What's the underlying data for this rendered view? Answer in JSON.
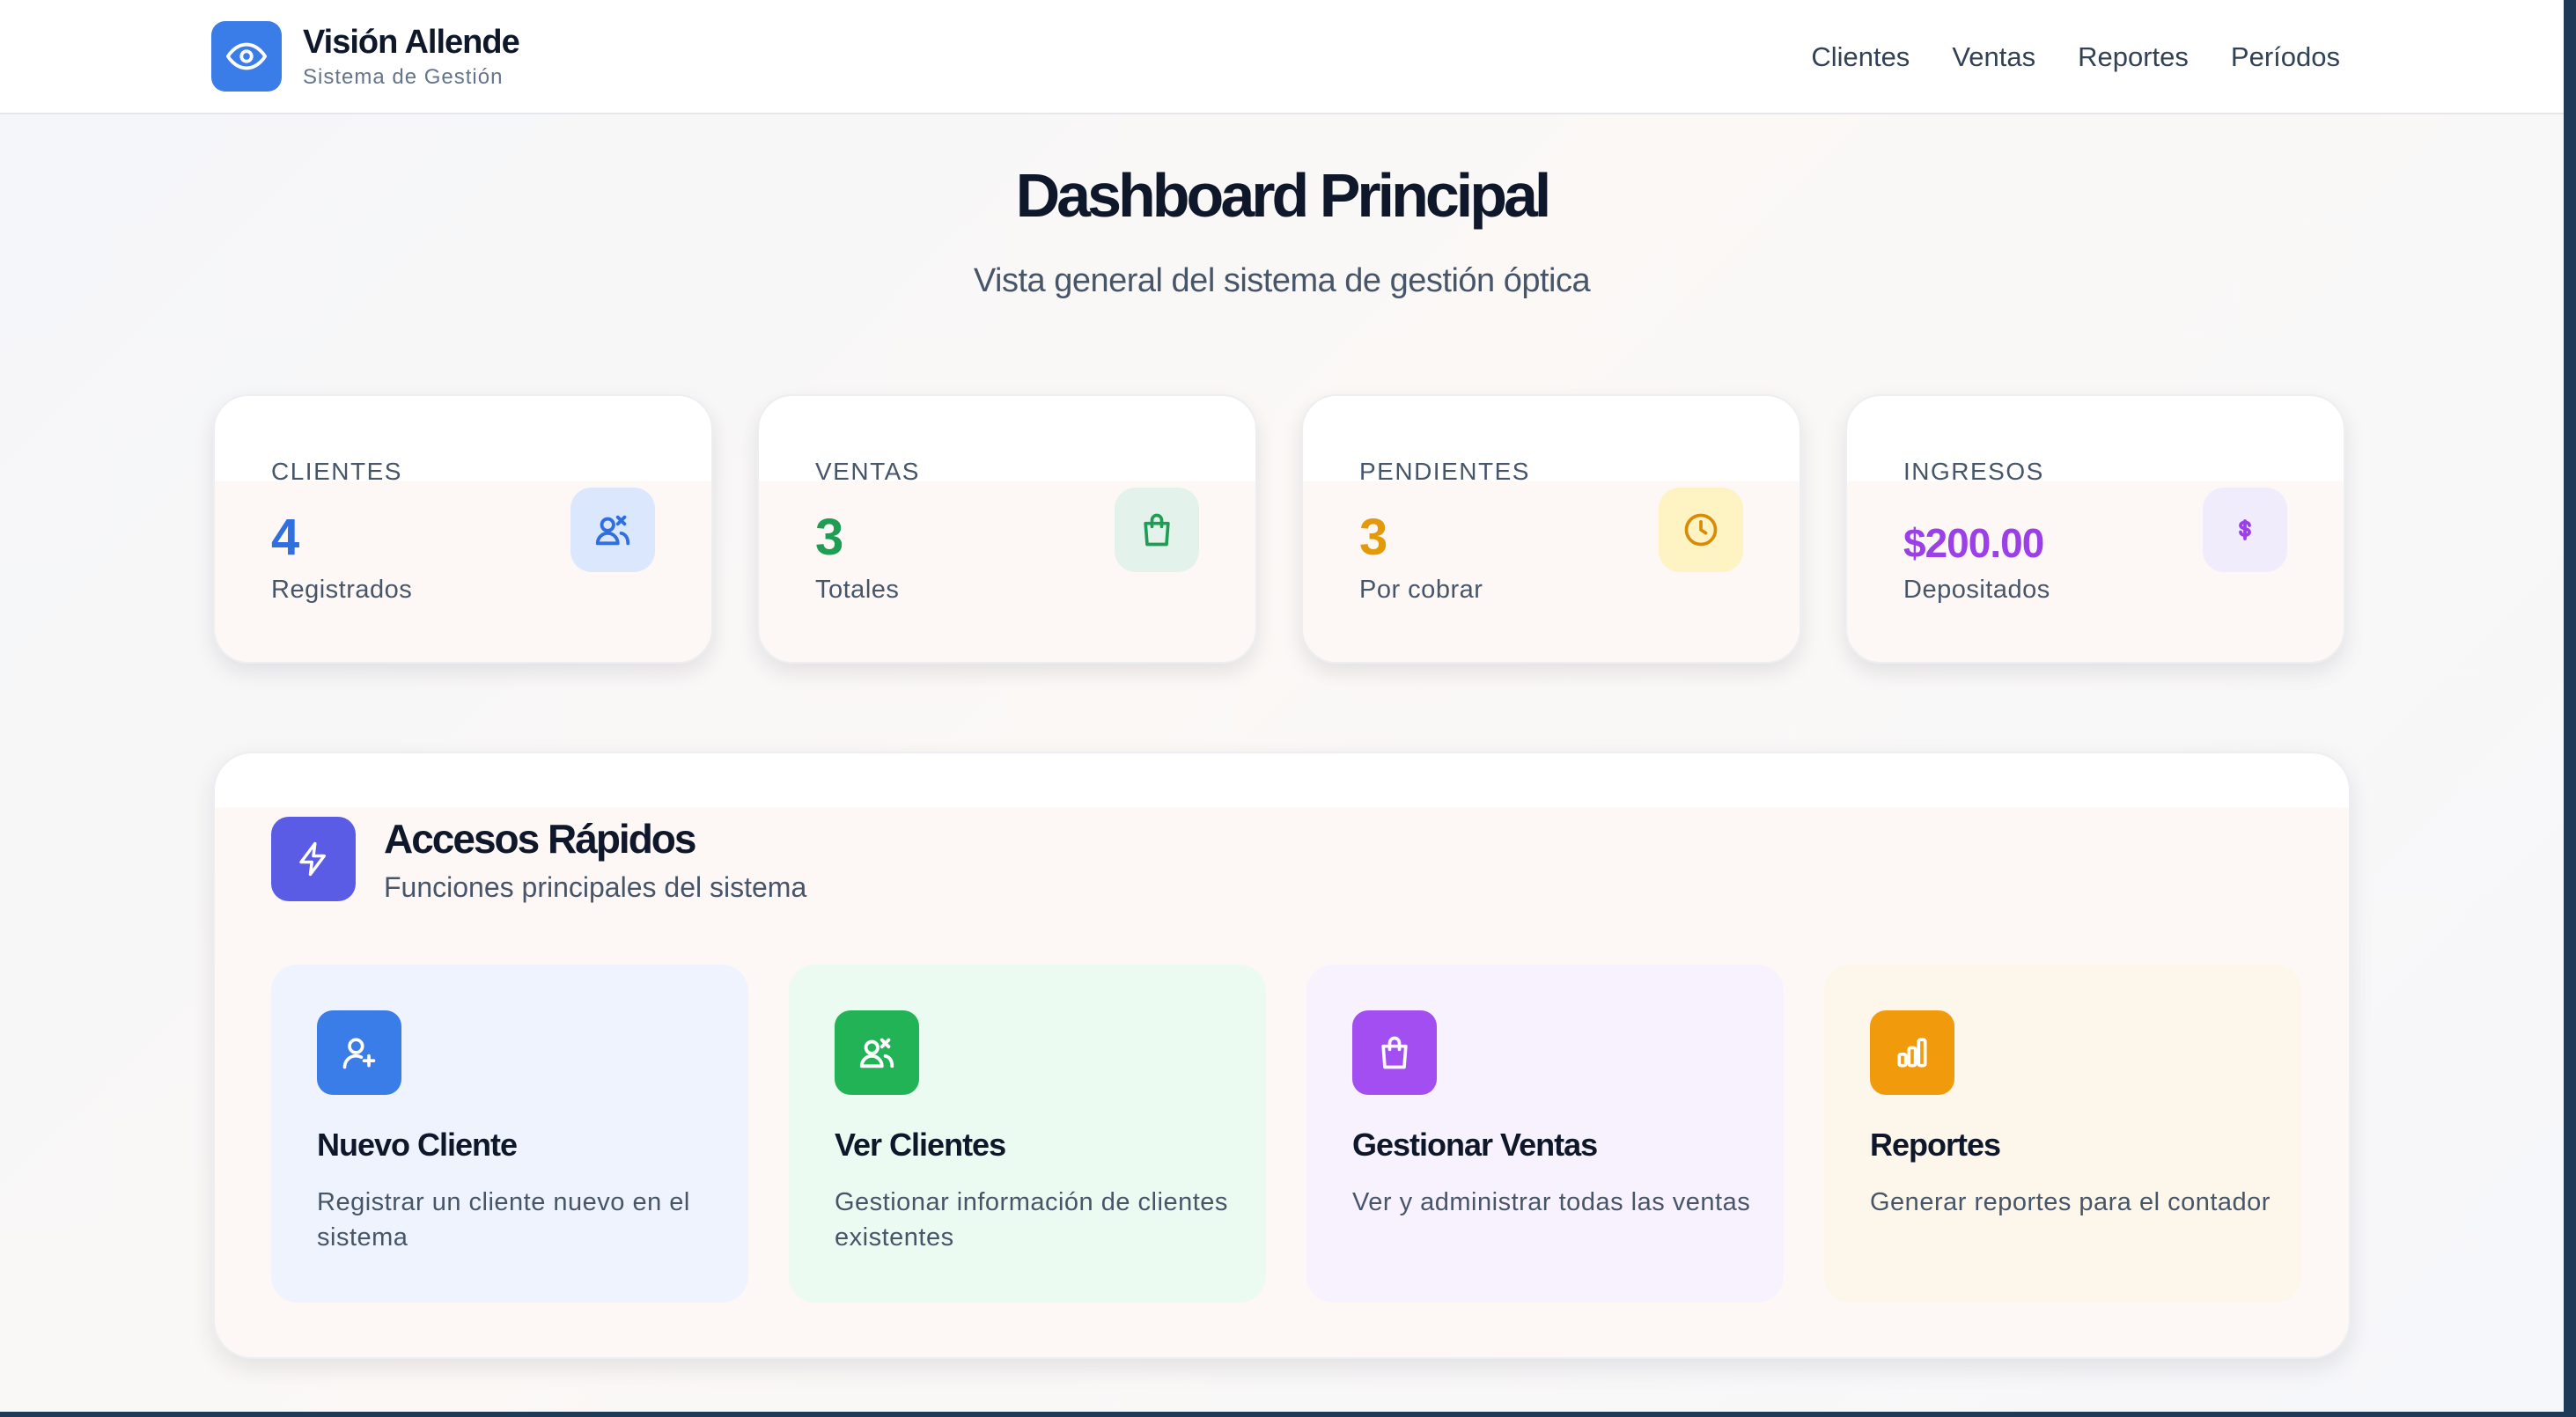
{
  "header": {
    "brand_title": "Visión Allende",
    "brand_subtitle": "Sistema de Gestión",
    "logo_icon": "eye-icon",
    "nav": [
      "Clientes",
      "Ventas",
      "Reportes",
      "Períodos"
    ]
  },
  "page": {
    "title": "Dashboard Principal",
    "subtitle": "Vista general del sistema de gestión óptica"
  },
  "stats": [
    {
      "label": "CLIENTES",
      "value": "4",
      "caption": "Registrados",
      "icon": "users-icon",
      "color": "#2f6fe0",
      "icon_bg": "#dbe7fd"
    },
    {
      "label": "VENTAS",
      "value": "3",
      "caption": "Totales",
      "icon": "shopping-bag-icon",
      "color": "#1f9d55",
      "icon_bg": "#e3f2ea"
    },
    {
      "label": "PENDIENTES",
      "value": "3",
      "caption": "Por cobrar",
      "icon": "clock-icon",
      "color": "#e39a0a",
      "icon_bg": "#fdf3c3"
    },
    {
      "label": "INGRESOS",
      "value": "$200.00",
      "caption": "Depositados",
      "icon": "dollar-icon",
      "color": "#9b3fe8",
      "icon_bg": "#f1ecfb"
    }
  ],
  "quick": {
    "title": "Accesos Rápidos",
    "subtitle": "Funciones principales del sistema",
    "icon": "lightning-icon",
    "tiles": [
      {
        "title": "Nuevo Cliente",
        "desc": "Registrar un cliente nuevo en el sistema",
        "icon": "user-plus-icon",
        "color": "#3b7de8",
        "bg": "#eef3fd"
      },
      {
        "title": "Ver Clientes",
        "desc": "Gestionar información de clientes existentes",
        "icon": "users-icon",
        "color": "#22b357",
        "bg": "#ecfbf1"
      },
      {
        "title": "Gestionar Ventas",
        "desc": "Ver y administrar todas las ventas",
        "icon": "shopping-bag-icon",
        "color": "#a34ef0",
        "bg": "#f7f2fe"
      },
      {
        "title": "Reportes",
        "desc": "Generar reportes para el contador",
        "icon": "bar-chart-icon",
        "color": "#f19b0c",
        "bg": "#fdf6ea"
      }
    ]
  }
}
